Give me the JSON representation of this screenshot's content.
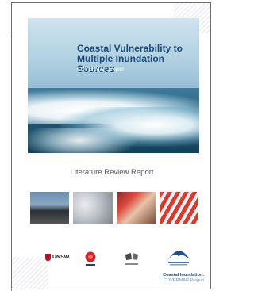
{
  "cover": {
    "title": "Coastal Vulnerability to Multiple Inundation Sources",
    "project": "COVERMAR project",
    "report_type": "Literature Review Report",
    "logos": {
      "unsw": "UNSW"
    },
    "footer": {
      "line1": "Coastal Inundation.",
      "line2": "COVERMAR Project"
    }
  }
}
